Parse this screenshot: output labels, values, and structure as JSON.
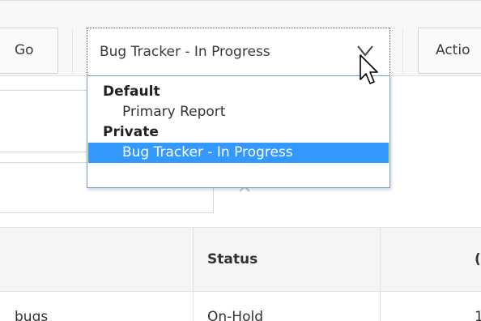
{
  "toolbar": {
    "go_label": "Go",
    "report_select_value": "Bug Tracker - In Progress",
    "actions_label": "Actio"
  },
  "report_dropdown": {
    "groups": [
      {
        "label": "Default",
        "options": [
          "Primary Report"
        ]
      },
      {
        "label": "Private",
        "options": [
          "Bug Tracker - In Progress"
        ]
      }
    ],
    "selected": "Bug Tracker - In Progress"
  },
  "grid": {
    "headers": [
      "",
      "Status",
      "("
    ],
    "rows": [
      [
        "bugs",
        "On-Hold",
        "1"
      ]
    ]
  },
  "icons": {
    "select_arrow": "chevron-down-icon",
    "filter_remove": "close-icon",
    "cursor": "arrow-pointer-icon"
  },
  "colors": {
    "selection_highlight": "#3399ff",
    "dropdown_border": "#7a9cc6"
  }
}
